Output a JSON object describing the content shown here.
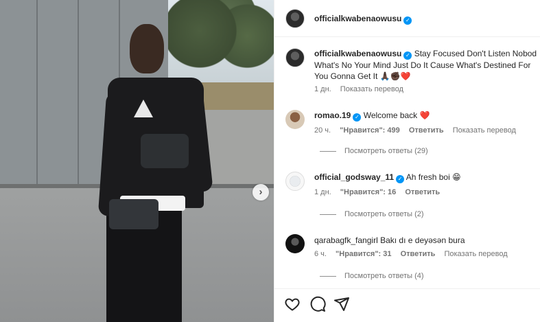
{
  "post": {
    "author": "officialkwabenaowusu",
    "caption_line1": "Stay Focused Don't Listen Nobod",
    "caption_line2": "What's No Your Mind Just Do It Cause What's Destined For",
    "caption_line3": "You Gonna Get It 🙏🏿✊🏿❤️",
    "time": "1 дн.",
    "translate": "Показать перевод",
    "icons": {
      "verified": "verified-badge-icon",
      "next": "chevron-right-icon",
      "like": "heart-outline-icon",
      "comment": "comment-bubble-icon",
      "share": "paper-plane-icon"
    }
  },
  "comments": [
    {
      "user": "romao.19",
      "verified": true,
      "text": "Welcome back",
      "emoji": "❤️",
      "time": "20 ч.",
      "likes": "\"Нравится\": 499",
      "reply": "Ответить",
      "translate": "Показать перевод",
      "replies": "Посмотреть ответы (29)"
    },
    {
      "user": "official_godsway_11",
      "verified": true,
      "text": "Ah fresh boi",
      "emoji": "😁",
      "time": "1 дн.",
      "likes": "\"Нравится\": 16",
      "reply": "Ответить",
      "replies": "Посмотреть ответы (2)"
    },
    {
      "user": "qarabagfk_fangirl",
      "verified": false,
      "text": "Bakı dı e deyəsən bura",
      "time": "6 ч.",
      "likes": "\"Нравится\": 31",
      "reply": "Ответить",
      "translate": "Показать перевод",
      "replies": "Посмотреть ответы (4)"
    }
  ],
  "colors": {
    "accent": "#0095f6",
    "like_red": "#ed4956",
    "muted": "#737373"
  }
}
